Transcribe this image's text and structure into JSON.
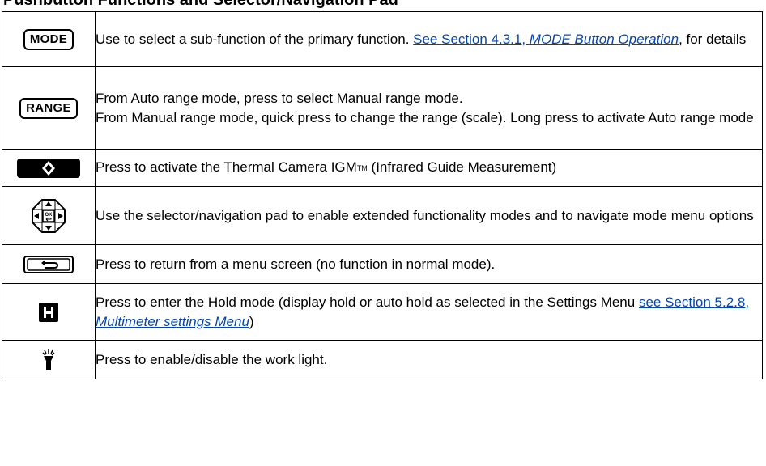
{
  "heading": "Pushbutton Functions and Selector/Navigation Pad",
  "rows": [
    {
      "icon": "mode-button-icon",
      "icon_label": "MODE",
      "text_before": "Use to select a sub-function of the primary function. ",
      "link_prefix": "See Section 4.3.1, ",
      "link_italic": "MODE Button Operation",
      "text_after": ", for details"
    },
    {
      "icon": "range-button-icon",
      "icon_label": "RANGE",
      "line1": "From Auto range mode, press to select Manual range mode.",
      "line2": "From Manual range mode, quick press to change the range (scale). Long press to activate Auto range mode"
    },
    {
      "icon": "thermal-camera-button-icon",
      "text_before": "Press to activate the Thermal Camera IGM",
      "trademark": "TM",
      "text_after": " (Infrared Guide Measurement)"
    },
    {
      "icon": "navigation-pad-icon",
      "icon_label": "OK",
      "text": "Use the selector/navigation pad to enable extended functionality modes and to navigate mode menu options"
    },
    {
      "icon": "back-button-icon",
      "text": "Press to return from a menu screen (no function in normal mode)."
    },
    {
      "icon": "hold-button-icon",
      "icon_label": "H",
      "text_before": "Press to enter the Hold mode (display hold or auto hold as selected in the Settings Menu ",
      "link_prefix": "see Section 5.2.8, ",
      "link_italic": "Multimeter settings Menu",
      "text_after": ")"
    },
    {
      "icon": "work-light-icon",
      "text": "Press to enable/disable the work light."
    }
  ],
  "colors": {
    "link": "#0645ad",
    "border": "#000000"
  }
}
